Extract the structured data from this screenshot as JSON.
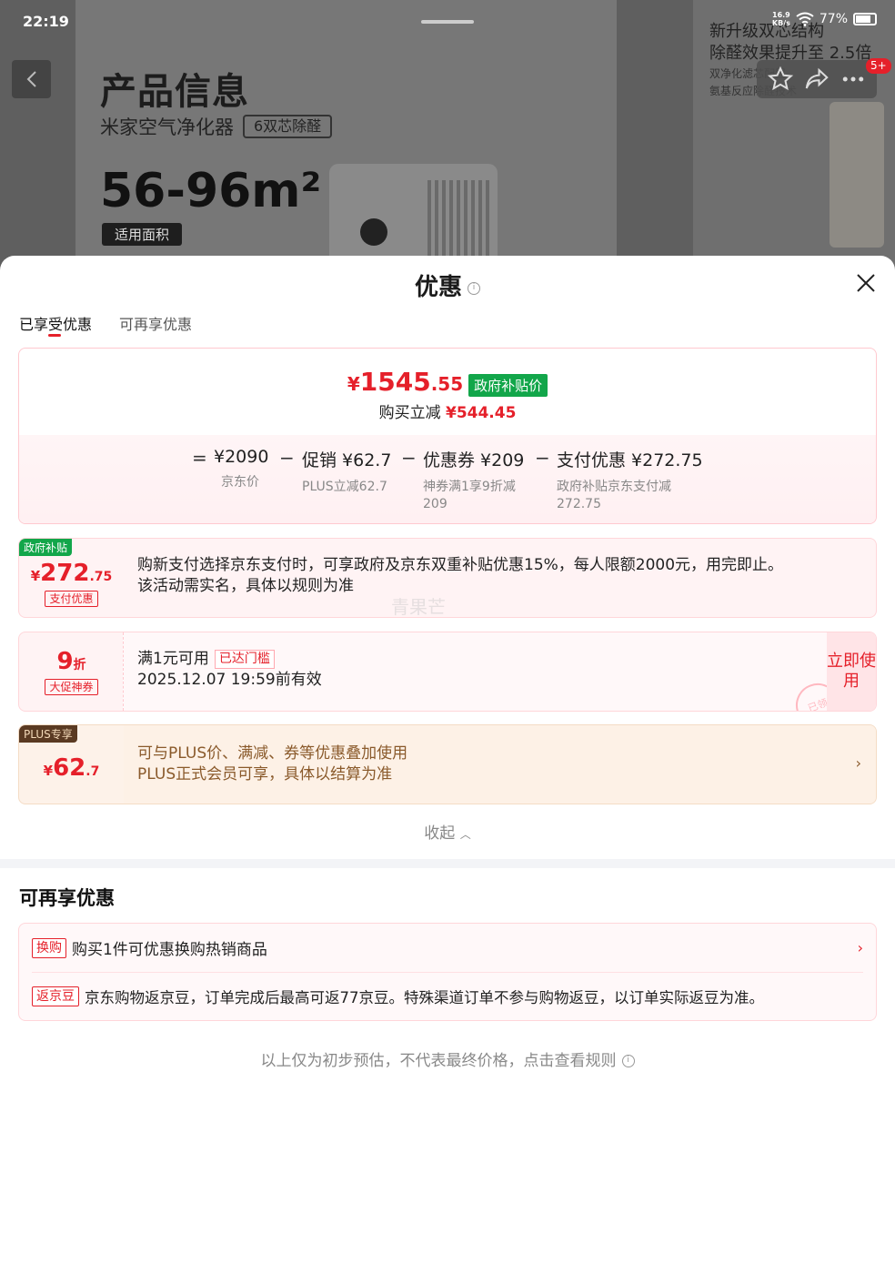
{
  "status_bar": {
    "time": "22:19",
    "net_speed_top": "16.9",
    "net_speed_bottom": "KB/s",
    "battery": "77%"
  },
  "background": {
    "title": "产品信息",
    "product_name": "米家空气净化器",
    "product_tag": "6双芯除醛",
    "area": "56-96m²",
    "area_label": "适用面积",
    "promo_line1": "新升级双芯结构",
    "promo_line2": "除醛效果提升至 2.5倍",
    "promo_line3": "双净化滤芯配置",
    "promo_line4": "氨基反应除醛技术",
    "badge": "5+"
  },
  "sheet": {
    "title": "优惠",
    "tabs": [
      {
        "label": "已享受优惠"
      },
      {
        "label": "可再享优惠"
      }
    ],
    "summary": {
      "currency": "¥",
      "final_int": "1545",
      "final_dec": ".55",
      "final_tag": "政府补贴价",
      "save_prefix": "购买立减",
      "save_amount": "¥544.45",
      "formula": [
        {
          "op": "=",
          "main": "¥2090",
          "sub": "京东价"
        },
        {
          "op": "−",
          "main": "促销 ¥62.7",
          "sub": "PLUS立减62.7"
        },
        {
          "op": "−",
          "main": "优惠券 ¥209",
          "sub": "神券满1享9折减\n209"
        },
        {
          "op": "−",
          "main": "支付优惠 ¥272.75",
          "sub": "政府补贴京东支付减\n272.75"
        }
      ]
    },
    "card_gov": {
      "corner": "政府补贴",
      "currency": "¥",
      "amount_int": "272",
      "amount_dec": ".75",
      "label": "支付优惠",
      "line1": "购新支付选择京东支付时，可享政府及京东双重补贴优惠15%，每人限额2000元，用完即止。",
      "line2": "该活动需实名，具体以规则为准"
    },
    "card_coupon": {
      "discount": "9",
      "unit": "折",
      "label": "大促神券",
      "condition": "满1元可用",
      "reached": "已达门槛",
      "expiry": "2025.12.07 19:59前有效",
      "use_button": "立即使用",
      "stamp": "已领"
    },
    "card_plus": {
      "corner": "PLUS专享",
      "currency": "¥",
      "amount_int": "62",
      "amount_dec": ".7",
      "line1": "可与PLUS价、满减、券等优惠叠加使用",
      "line2": "PLUS正式会员可享，具体以结算为准"
    },
    "collapse_label": "收起",
    "more_section": {
      "title": "可再享优惠",
      "rows": [
        {
          "tag": "换购",
          "text": "购买1件可优惠换购热销商品"
        },
        {
          "tag": "返京豆",
          "text": "京东购物返京豆，订单完成后最高可返77京豆。特殊渠道订单不参与购物返豆，以订单实际返豆为准。"
        }
      ]
    },
    "footnote": "以上仅为初步预估，不代表最终价格，点击查看规则",
    "watermark": "青果芒"
  },
  "colors": {
    "accent": "#e5202a",
    "gov_green": "#12a64a",
    "plus_brown": "#8a5a2b"
  }
}
